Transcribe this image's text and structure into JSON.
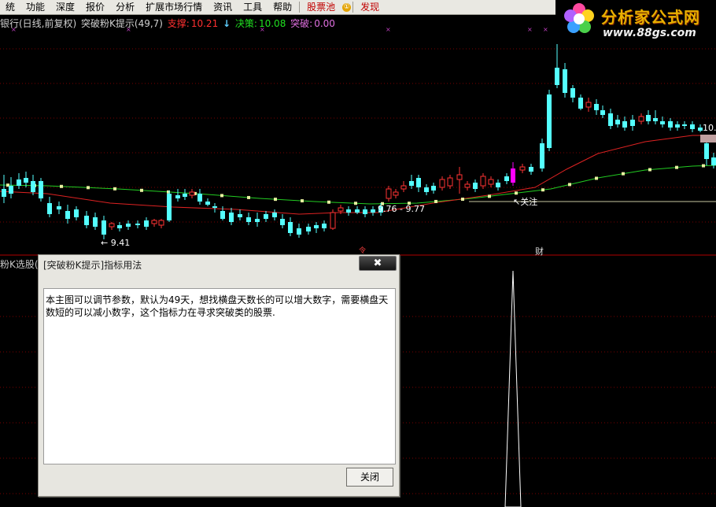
{
  "menu": {
    "items": [
      {
        "label": "统",
        "red": false
      },
      {
        "label": "功能",
        "red": false
      },
      {
        "label": "深度",
        "red": false
      },
      {
        "label": "报价",
        "red": false
      },
      {
        "label": "分析",
        "red": false
      },
      {
        "label": "扩展市场行情",
        "red": false
      },
      {
        "label": "资讯",
        "red": false
      },
      {
        "label": "工具",
        "red": false
      },
      {
        "label": "帮助",
        "red": false
      },
      {
        "label": "股票池",
        "red": true,
        "badge": "①"
      },
      {
        "label": "发现",
        "red": true
      }
    ]
  },
  "logo": {
    "title": "分析家公式网",
    "url": "www.88gs.com"
  },
  "info": {
    "stock": "银行(日线,前复权)",
    "indicator": "突破粉K提示(49,7)",
    "support_label": "支撑:",
    "support_value": "10.21",
    "decision_label": "决策:",
    "decision_value": "10.08",
    "break_label": "突破:",
    "break_value": "0.00"
  },
  "chart_labels": {
    "low_price": "9.41",
    "range_price": "9.76 - 9.77",
    "attention": "关注",
    "right_price": "10.",
    "marker_cai": "财",
    "marker_left": "令"
  },
  "sub_panel": {
    "label": "粉K选股("
  },
  "dialog": {
    "title": "[突破粉K提示]指标用法",
    "close_glyph": "✖",
    "text": "本主图可以调节参数，默认为49天，想找横盘天数长的可以增大数字，需要横盘天数短的可以减小数字，这个指标力在寻求突破类的股票.",
    "button": "关闭"
  },
  "colors": {
    "up": "#ff3333",
    "down": "#54ffff",
    "pink": "#ff00ff",
    "ma_long": "#22cc22",
    "ma_short": "#dd2222",
    "grid": "#7a0000",
    "support_line": "#c8c8a0"
  }
}
